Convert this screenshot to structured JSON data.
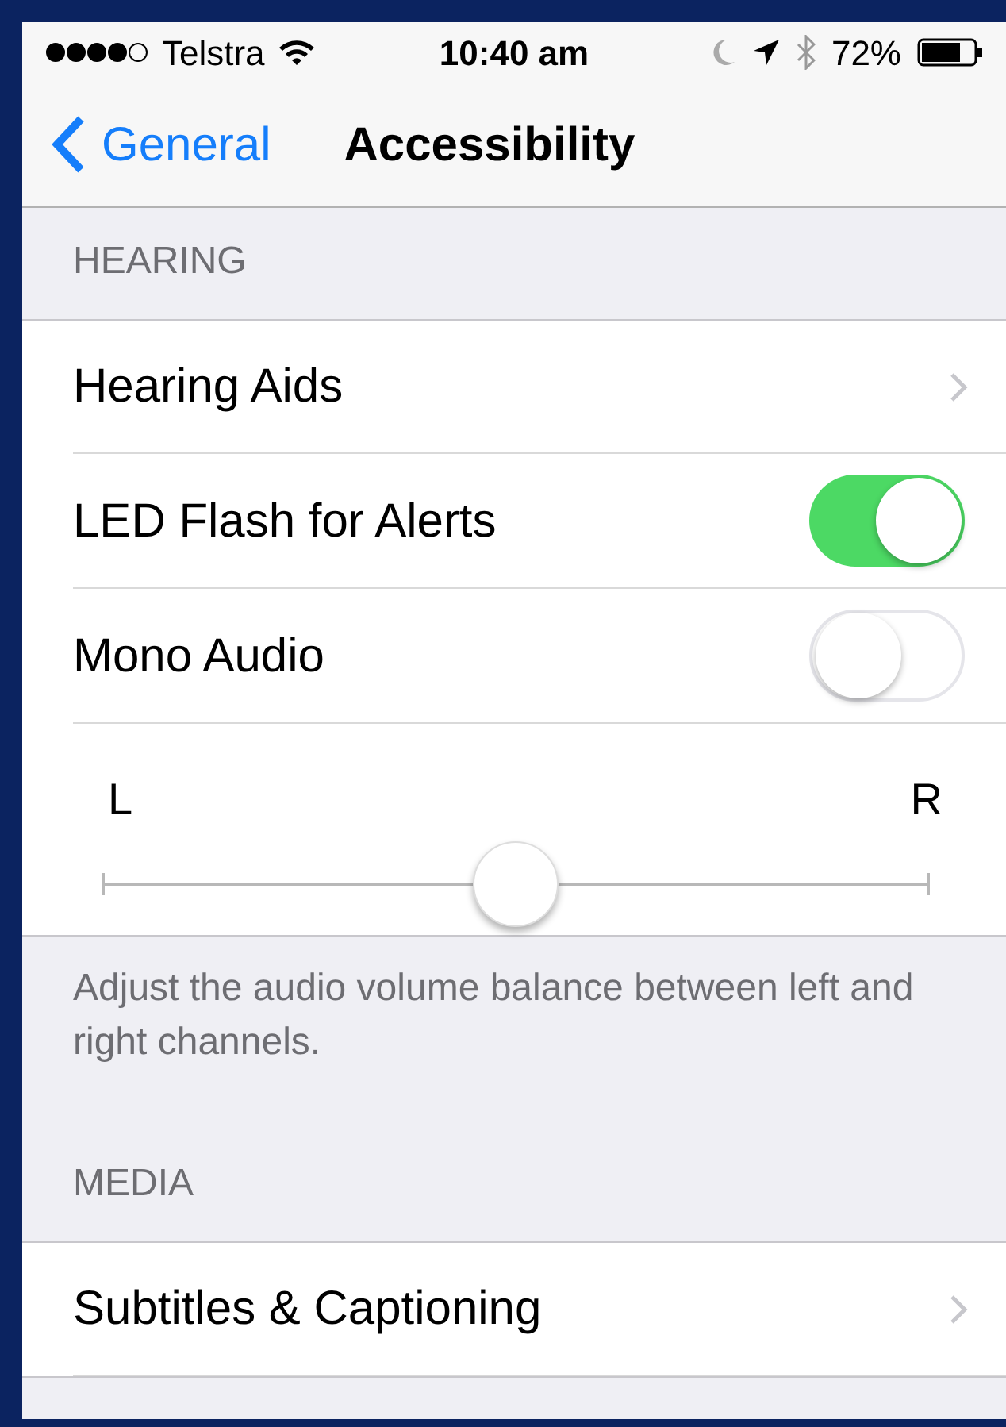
{
  "status_bar": {
    "carrier": "Telstra",
    "time": "10:40 am",
    "battery": "72%"
  },
  "nav": {
    "back": "General",
    "title": "Accessibility"
  },
  "sections": [
    {
      "header": "HEARING",
      "rows": [
        {
          "kind": "link",
          "label": "Hearing Aids"
        },
        {
          "kind": "switch",
          "label": "LED Flash for Alerts",
          "on": true
        },
        {
          "kind": "switch",
          "label": "Mono Audio",
          "on": false
        },
        {
          "kind": "slider",
          "left": "L",
          "right": "R",
          "level": 0.5
        }
      ],
      "footer": "Adjust the audio volume balance between left and right channels."
    },
    {
      "header": "MEDIA",
      "rows": [
        {
          "kind": "link",
          "label": "Subtitles & Captioning"
        },
        {
          "kind": "partial"
        }
      ]
    }
  ]
}
